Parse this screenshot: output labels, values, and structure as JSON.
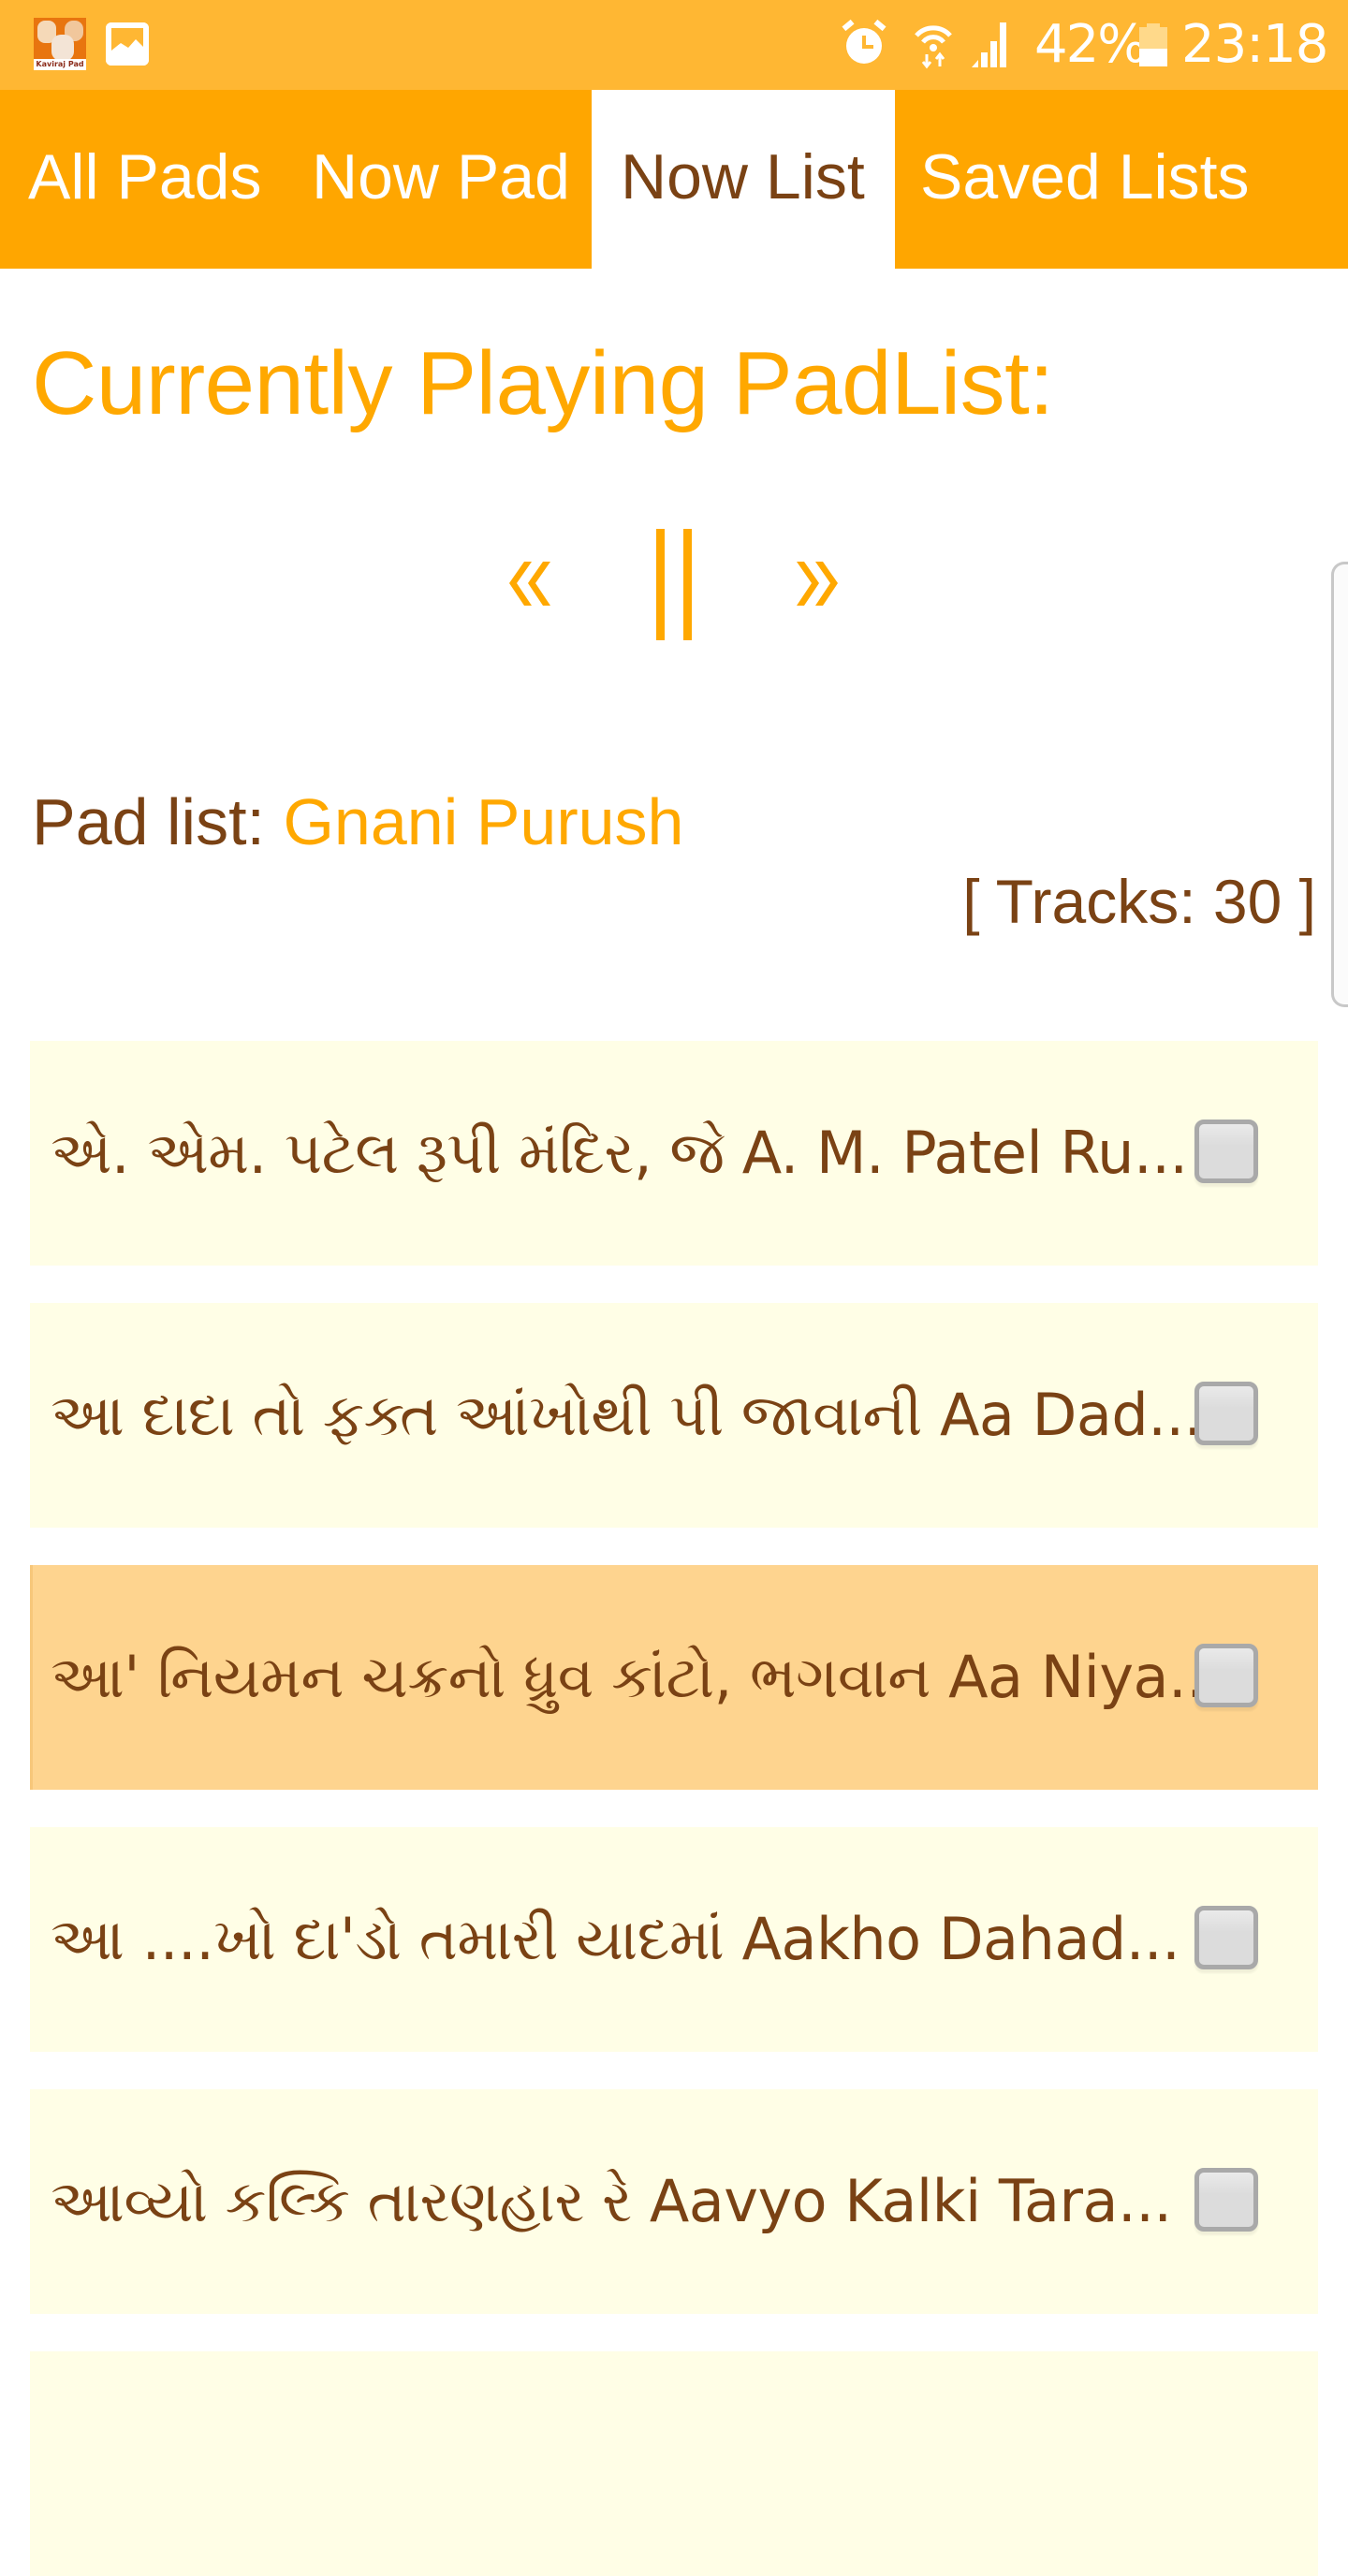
{
  "status_bar": {
    "app_icon_caption": "Kaviraj Pad",
    "icons": [
      "app-icon",
      "gallery-icon",
      "alarm-icon",
      "wifi-icon",
      "signal-icon",
      "battery-icon"
    ],
    "battery_percent": "42%",
    "time": "23:18"
  },
  "tabs": [
    {
      "label": "All Pads",
      "active": false
    },
    {
      "label": "Now Pad",
      "active": false
    },
    {
      "label": "Now List",
      "active": true
    },
    {
      "label": "Saved Lists",
      "active": false
    }
  ],
  "player": {
    "heading": "Currently Playing PadList:",
    "controls": {
      "previous": "«",
      "pause": "||",
      "next": "»"
    }
  },
  "padlist": {
    "label": "Pad list:",
    "name": "Gnani Purush",
    "tracks_text": "[ Tracks: 30 ]",
    "track_count": 30
  },
  "items": [
    {
      "title": "એ. એમ. પટેલ રૂપી મંદિર, જે A. M. Patel Ru...",
      "checked": false,
      "current": false
    },
    {
      "title": "આ દાદા તો ફક્ત આંખોથી પી જાવાની Aa Dad...",
      "checked": false,
      "current": false
    },
    {
      "title": "આ' નિયમન ચક્રનો ધ્રુવ કાંટો, ભગવાન Aa Niya...",
      "checked": false,
      "current": true
    },
    {
      "title": "આ ....ખો દા'ડો તમારી યાદમાં Aakho Dahad...",
      "checked": false,
      "current": false
    },
    {
      "title": "આવ્યો કલ્કિ તારણહાર રે Aavyo Kalki Tara...",
      "checked": false,
      "current": false
    },
    {
      "title": "",
      "checked": false,
      "current": false
    }
  ],
  "colors": {
    "status_bar": "#ffb733",
    "tab_bar": "#ffa600",
    "accent": "#ffa800",
    "text_brown": "#7a4214",
    "item_bg": "#fffee6",
    "item_current_bg": "#fed48f"
  }
}
